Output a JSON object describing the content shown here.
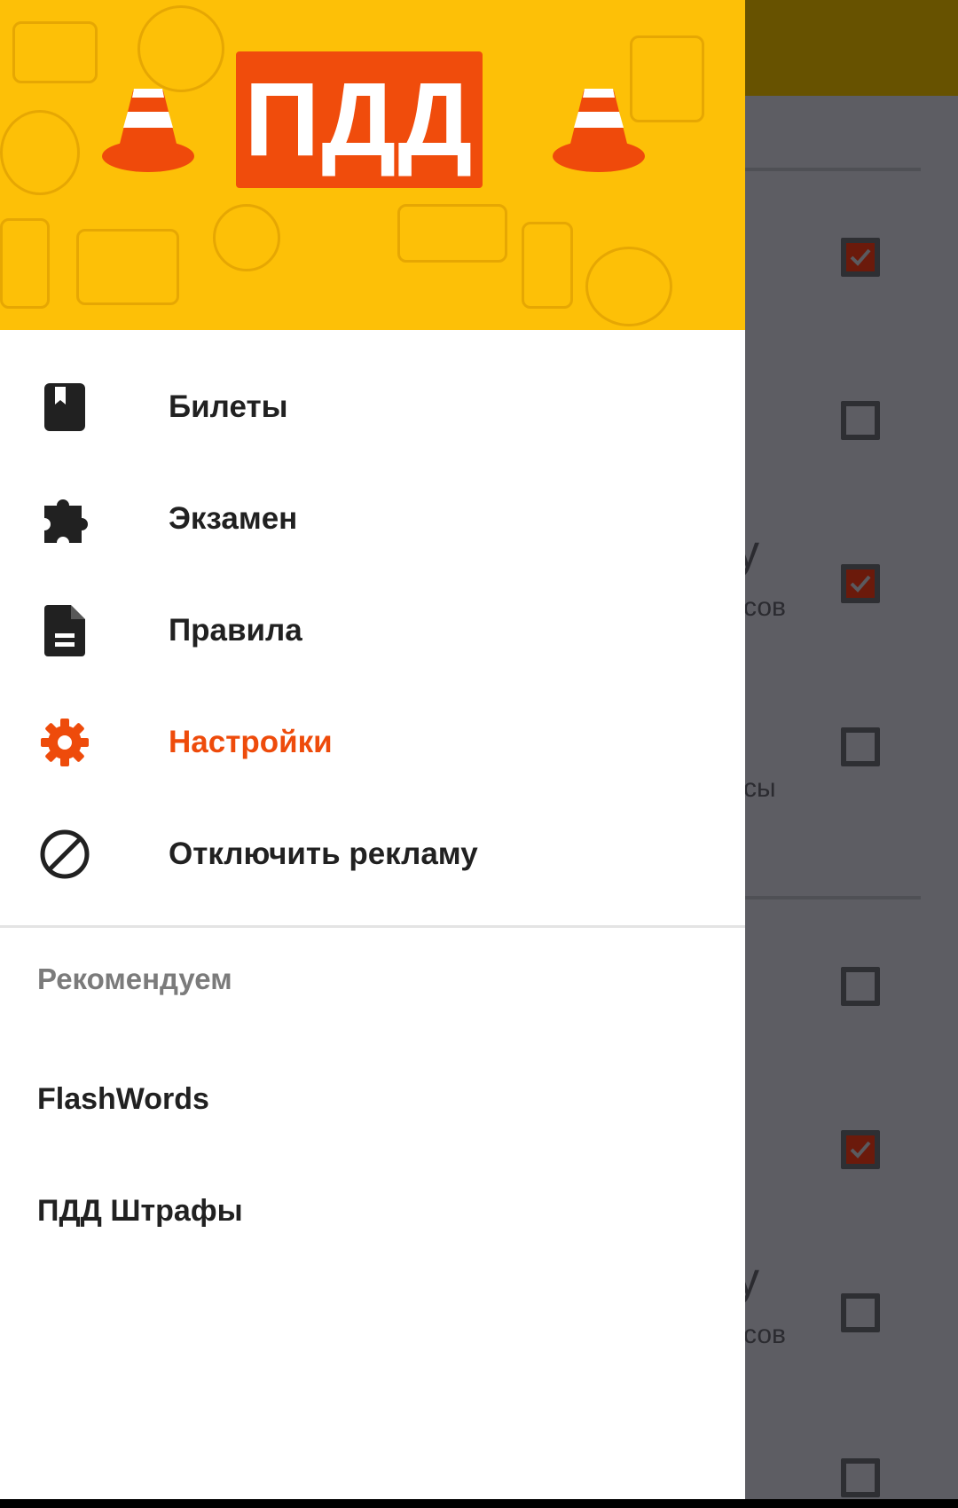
{
  "header": {
    "logo_text": "ПДД"
  },
  "menu": {
    "items": [
      {
        "label": "Билеты",
        "icon": "book-bookmark-icon",
        "active": false
      },
      {
        "label": "Экзамен",
        "icon": "puzzle-icon",
        "active": false
      },
      {
        "label": "Правила",
        "icon": "document-icon",
        "active": false
      },
      {
        "label": "Настройки",
        "icon": "gear-icon",
        "active": true
      },
      {
        "label": "Отключить рекламу",
        "icon": "block-icon",
        "active": false
      }
    ]
  },
  "recommended": {
    "header": "Рекомендуем",
    "items": [
      {
        "label": "FlashWords"
      },
      {
        "label": "ПДД Штрафы"
      }
    ]
  },
  "background": {
    "peek_texts": [
      "у",
      "сов",
      "сы",
      "у",
      "сов"
    ],
    "checkboxes": [
      true,
      false,
      true,
      false,
      false,
      true,
      false,
      false
    ]
  },
  "colors": {
    "accent": "#ee4b0b",
    "header_bg": "#fdc007",
    "checkbox_checked": "#6b1a0b"
  }
}
